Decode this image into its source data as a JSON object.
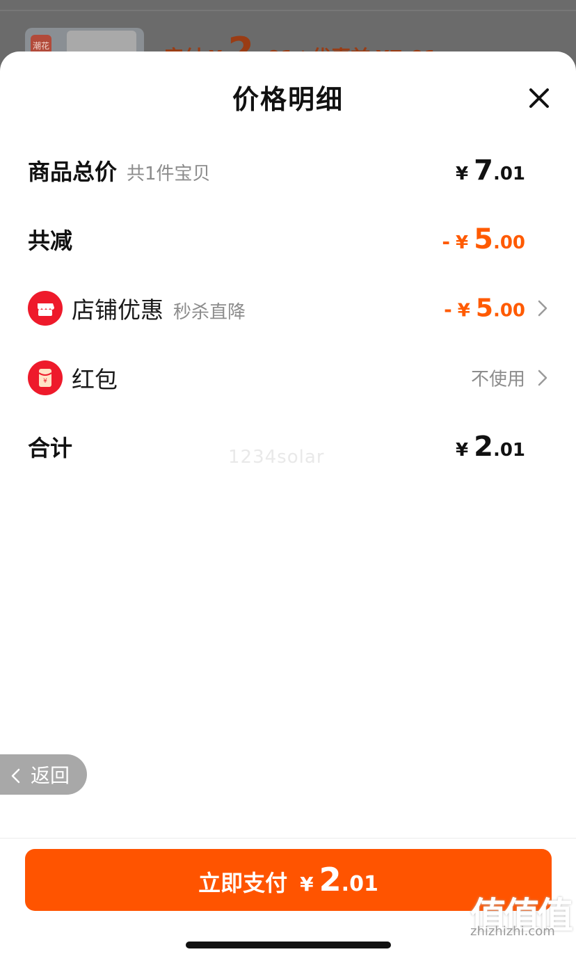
{
  "background": {
    "thumb_tag": "潮花",
    "price_label": "实付",
    "price_yen": "¥",
    "price_int": "2",
    "price_dec": ".01",
    "separator": "|",
    "before_label": "优惠前",
    "before_value": "¥7.01"
  },
  "sheet": {
    "title": "价格明细",
    "close_icon": "close-icon"
  },
  "rows": {
    "subtotal": {
      "label": "商品总价",
      "sub": "共1件宝贝",
      "yen": "¥",
      "int": "7",
      "dec": ".01"
    },
    "reduction": {
      "label": "共减",
      "minus": "-",
      "yen": "¥",
      "int": "5",
      "dec": ".00"
    },
    "store_discount": {
      "label": "店铺优惠",
      "sub": "秒杀直降",
      "minus": "-",
      "yen": "¥",
      "int": "5",
      "dec": ".00",
      "icon": "store-icon"
    },
    "red_packet": {
      "label": "红包",
      "value": "不使用",
      "icon": "red-packet-icon"
    },
    "total": {
      "label": "合计",
      "yen": "¥",
      "int": "2",
      "dec": ".01"
    }
  },
  "watermark": "1234solar",
  "back": {
    "label": "返回"
  },
  "pay": {
    "label": "立即支付",
    "yen": "¥",
    "int": "2",
    "dec": ".01"
  },
  "corner": {
    "glyphs": "值值值",
    "domain": "zhizhizhi.com"
  },
  "colors": {
    "accent": "#ff5400",
    "discount": "#ff5a00",
    "icon_red": "#ee1a2b",
    "muted": "#8c8c8c"
  }
}
